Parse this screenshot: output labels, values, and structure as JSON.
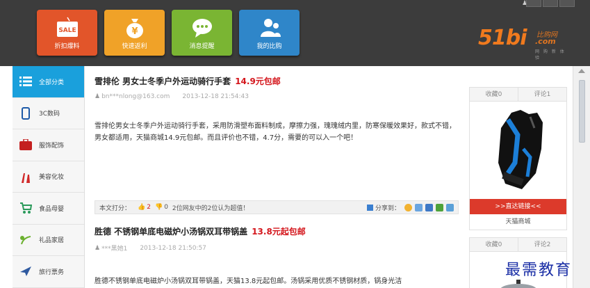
{
  "tiles": [
    {
      "label": "折扣爆料",
      "icon": "sale-tag-icon",
      "badge": "SALE",
      "color": "#e2552a"
    },
    {
      "label": "快速返利",
      "icon": "money-bag-icon",
      "badge": "¥",
      "color": "#f0a228"
    },
    {
      "label": "消息提醒",
      "icon": "chat-bubble-icon",
      "badge": "",
      "color": "#7ab533"
    },
    {
      "label": "我的比购",
      "icon": "users-icon",
      "badge": "",
      "color": "#2f86c9"
    }
  ],
  "logo": {
    "main": "51bi",
    "sub": "比购网",
    "com": ".com",
    "tagline": "网 购 新 体 验"
  },
  "sidebar": {
    "items": [
      {
        "label": "全部分类",
        "icon": "list-icon",
        "active": true
      },
      {
        "label": "3C数码",
        "icon": "phone-icon"
      },
      {
        "label": "服饰配饰",
        "icon": "bag-icon"
      },
      {
        "label": "美容化妆",
        "icon": "cosmetics-icon"
      },
      {
        "label": "食品母婴",
        "icon": "stroller-icon"
      },
      {
        "label": "礼品家居",
        "icon": "gift-icon"
      },
      {
        "label": "旅行票务",
        "icon": "plane-icon"
      }
    ]
  },
  "posts": [
    {
      "title": "雪排伦 男女士冬季户外运动骑行手套",
      "price": "14.9元包邮",
      "user": "bn***nlong@163.com",
      "date": "2013-12-18 21:54:43",
      "desc": "雪排伦男女士冬季户外运动骑行手套，采用防滑塑布面料制成，摩擦力强，瑰瑰绒内里，防寒保暖效果好，款式不错，男女都适用，天猫商城14.9元包邮。而且评价也不错，4.7分，需要的可以入一个吧！"
    },
    {
      "title": "胜德 不锈钢单底电磁炉小汤锅双耳带锅盖",
      "price": "13.8元起包邮",
      "user": "***黑她1",
      "date": "2013-12-18 21:50:57",
      "desc": "胜德不锈钢单底电磁炉小汤锅双耳带锅盖，天猫13.8元起包邮。汤锅采用优质不锈钢材质，锅身光洁"
    }
  ],
  "rating_bar": {
    "label": "本文打分：",
    "up": "2",
    "down": "0",
    "summary": "2位网友中的2位认为超值！",
    "share_label": "分享到："
  },
  "cards": [
    {
      "fav": "收藏0",
      "comment": "评论1",
      "button": ">>直达链接<<",
      "store": "天猫商城",
      "image": "glove-image"
    },
    {
      "fav": "收藏0",
      "comment": "评论2",
      "image": "pot-image"
    }
  ],
  "watermark": "最需教育",
  "colors": {
    "accent": "#1aa0dc",
    "price": "#d4161c",
    "button": "#dc3a2b",
    "logo": "#f07a1e"
  }
}
